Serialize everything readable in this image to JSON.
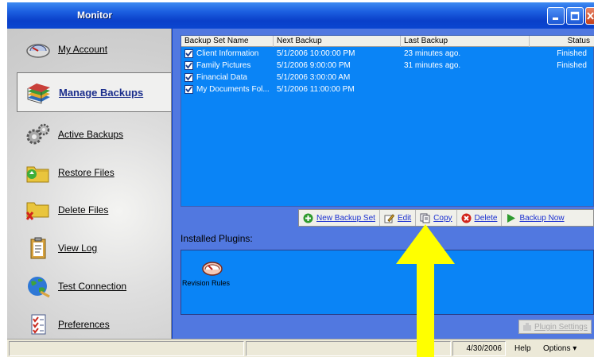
{
  "window": {
    "title": "Monitor"
  },
  "sidebar": {
    "items": [
      {
        "label": "My Account",
        "icon": "speedometer-icon"
      },
      {
        "label": "Manage Backups",
        "icon": "books-icon",
        "selected": true
      },
      {
        "label": "Active Backups",
        "icon": "gears-icon"
      },
      {
        "label": "Restore Files",
        "icon": "folder-restore-icon"
      },
      {
        "label": "Delete Files",
        "icon": "folder-delete-icon"
      },
      {
        "label": "View Log",
        "icon": "clipboard-icon"
      },
      {
        "label": "Test Connection",
        "icon": "globe-icon"
      },
      {
        "label": "Preferences",
        "icon": "checklist-icon"
      }
    ]
  },
  "backups": {
    "columns": [
      "Backup Set Name",
      "Next Backup",
      "Last Backup",
      "Status"
    ],
    "rows": [
      {
        "name": "Client Information",
        "next": "5/1/2006 10:00:00 PM",
        "last": "23 minutes ago.",
        "status": "Finished",
        "checked": true
      },
      {
        "name": "Family Pictures",
        "next": "5/1/2006 9:00:00 PM",
        "last": "31 minutes ago.",
        "status": "Finished",
        "checked": true
      },
      {
        "name": "Financial Data",
        "next": "5/1/2006 3:00:00 AM",
        "last": "",
        "status": "",
        "checked": true
      },
      {
        "name": "My Documents Fol...",
        "next": "5/1/2006 11:00:00 PM",
        "last": "",
        "status": "",
        "checked": true
      }
    ]
  },
  "actions": {
    "new_backup_set": "New Backup Set",
    "edit": "Edit",
    "copy": "Copy",
    "delete": "Delete",
    "backup_now": "Backup Now"
  },
  "plugins": {
    "label": "Installed Plugins:",
    "items": [
      {
        "name": "Revision Rules",
        "icon": "gauge-icon"
      }
    ],
    "settings_button": "Plugin Settings"
  },
  "statusbar": {
    "date": "4/30/2006",
    "help": "Help",
    "options": "Options ▾"
  },
  "colors": {
    "accent": "#0a84f6",
    "panel": "#5178e0",
    "titlebar": "#1c5fe0",
    "arrow": "#ffff00"
  }
}
